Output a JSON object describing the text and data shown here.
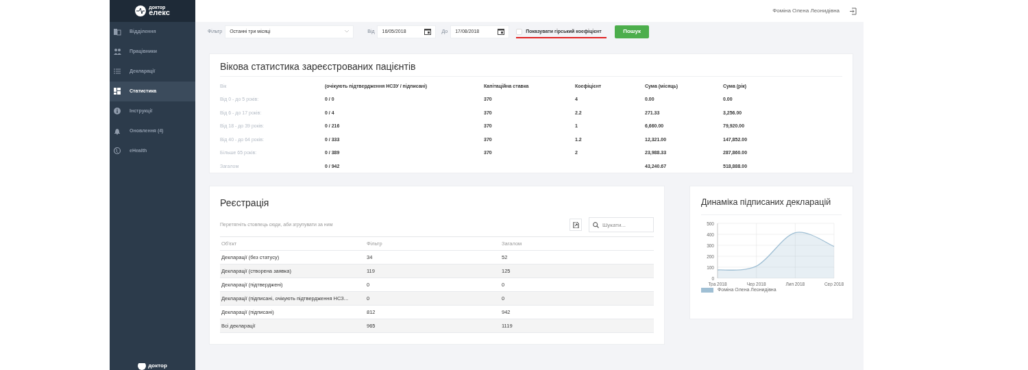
{
  "brand": {
    "line1": "доктор",
    "line2": "елекс"
  },
  "sidebar": {
    "items": [
      {
        "label": "Відділення",
        "selected": false
      },
      {
        "label": "Працівники",
        "selected": false
      },
      {
        "label": "Декларації",
        "selected": false
      },
      {
        "label": "Статистика",
        "selected": true
      },
      {
        "label": "Інструкції",
        "selected": false
      },
      {
        "label": "Оновлення (4)",
        "selected": false
      },
      {
        "label": "eHealth",
        "selected": false
      }
    ]
  },
  "footer_brand": "доктор",
  "header": {
    "user": "Фоміна Олена Леонидівна"
  },
  "filter": {
    "label": "Фільтр",
    "period": "Останні три місяці",
    "from_label": "Від",
    "from": "16/05/2018",
    "to_label": "До",
    "to": "17/08/2018",
    "checkbox": {
      "label": "Показувати гірський коефіцієнт",
      "checked": false,
      "underlined": true
    },
    "search_button": "Пошук"
  },
  "age_stats": {
    "title": "Вікова статистика зареєстрованих пацієнтів",
    "columns": [
      "Вік",
      "(очікують підтвердження НСЗУ / підписані)",
      "Капітаційна ставка",
      "Коефіцієнт",
      "Сума (місяць)",
      "Сума (рік)"
    ],
    "rows": [
      {
        "age": "Від 0 - до 5 років:",
        "ratio": "0 / 0",
        "rate": "370",
        "coefficient": "4",
        "sum_month": "0.00",
        "sum_year": "0.00"
      },
      {
        "age": "Від 6 - до 17 років:",
        "ratio": "0 / 4",
        "rate": "370",
        "coefficient": "2.2",
        "sum_month": "271.33",
        "sum_year": "3,256.00"
      },
      {
        "age": "Від 18 - до 39 років:",
        "ratio": "0 / 216",
        "rate": "370",
        "coefficient": "1",
        "sum_month": "6,660.00",
        "sum_year": "79,920.00"
      },
      {
        "age": "Від 40 - до 64 років:",
        "ratio": "0 / 333",
        "rate": "370",
        "coefficient": "1.2",
        "sum_month": "12,321.00",
        "sum_year": "147,852.00"
      },
      {
        "age": "Більше 65 років:",
        "ratio": "0 / 389",
        "rate": "370",
        "coefficient": "2",
        "sum_month": "23,988.33",
        "sum_year": "287,860.00"
      },
      {
        "age": "Загалом",
        "ratio": "0 / 942",
        "sum_month": "43,240.67",
        "sum_year": "518,888.00"
      }
    ]
  },
  "registration": {
    "title": "Реєстрація",
    "group_hint": "Перетягніть стовпець сюди, аби згрупувати за ним",
    "search_placeholder": "Шукати...",
    "columns": [
      "Об'єкт",
      "Фільтр",
      "Загалом"
    ],
    "rows": [
      {
        "object": "Декларації (без статусу)",
        "filter": "34",
        "total": "52"
      },
      {
        "object": "Декларації (створена заявка)",
        "filter": "119",
        "total": "125"
      },
      {
        "object": "Декларації (підтверджені)",
        "filter": "0",
        "total": "0"
      },
      {
        "object": "Декларації (підписані, очікують підтвердження НСЗ...",
        "filter": "0",
        "total": "0"
      },
      {
        "object": "Декларації (підписані)",
        "filter": "812",
        "total": "942"
      },
      {
        "object": "Всі декларації",
        "filter": "965",
        "total": "1119"
      }
    ]
  },
  "dynamics": {
    "title": "Динаміка підписаних декларацій",
    "chart_data": {
      "type": "area",
      "grid": true,
      "categories": [
        "Тра 2018",
        "Чер 2018",
        "Лип 2018",
        "Сер 2018"
      ],
      "ylim": [
        0,
        500
      ],
      "yticks": [
        0,
        100,
        200,
        300,
        400,
        500
      ],
      "series": [
        {
          "name": "Фоміна Олена Леонидівна",
          "color": "#9fbfd4",
          "values": [
            75,
            110,
            415,
            290
          ]
        }
      ]
    }
  }
}
